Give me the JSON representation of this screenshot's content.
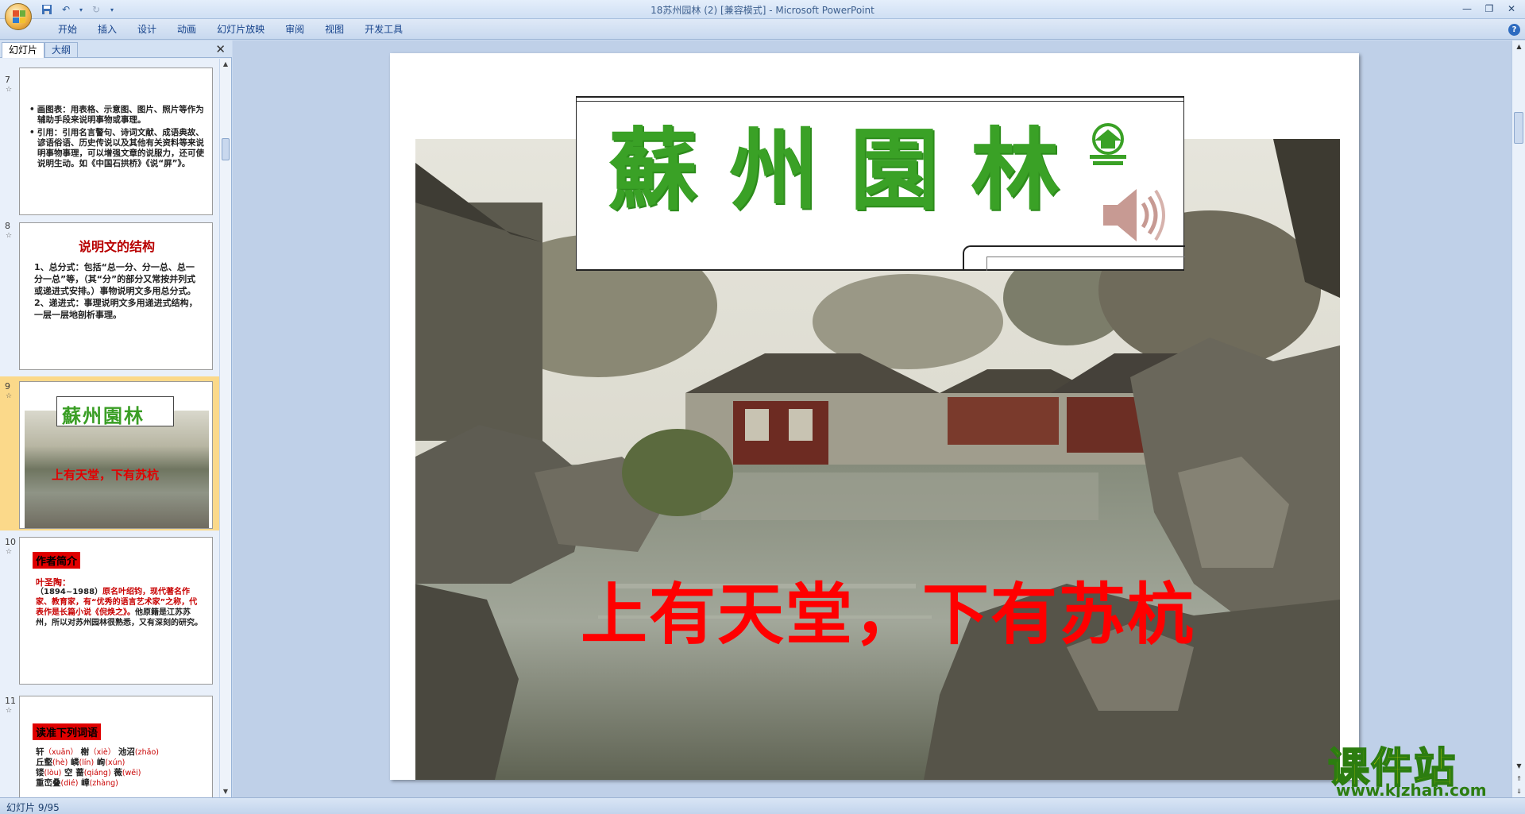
{
  "window": {
    "title": "18苏州园林 (2) [兼容模式] - Microsoft PowerPoint"
  },
  "ribbon": {
    "tabs": [
      "开始",
      "插入",
      "设计",
      "动画",
      "幻灯片放映",
      "审阅",
      "视图",
      "开发工具"
    ]
  },
  "panel": {
    "tab_slides": "幻灯片",
    "tab_outline": "大纲",
    "close": "✕"
  },
  "thumbnails": [
    {
      "number": "7",
      "bullets": [
        "画图表：用表格、示意图、图片、照片等作为辅助手段来说明事物或事理。",
        "引用：引用名言警句、诗词文献、成语典故、谚语俗语、历史传说以及其他有关资料等来说明事物事理，可以增强文章的说服力，还可使说明生动。如《中国石拱桥》《说“屏”》。"
      ]
    },
    {
      "number": "8",
      "title": "说明文的结构",
      "lines": [
        "1、总分式：包括“总一分、分一总、总一分一总”等，（其“分”的部分又常按并列式或递进式安排。）事物说明文多用总分式。",
        "2、递进式：事理说明文多用递进式结构，一层一层地剖析事理。"
      ]
    },
    {
      "number": "9",
      "banner": "蘇州園林",
      "caption": "上有天堂，下有苏杭"
    },
    {
      "number": "10",
      "label": "作者简介",
      "name": "叶圣陶：",
      "years": "（1894~1988）",
      "red_text": "原名叶绍钧，现代著名作家、教育家，有“优秀的语言艺术家”之称，代表作是长篇小说《倪焕之》。",
      "black_text": "他原籍是江苏苏州，所以对苏州园林很熟悉，又有深刻的研究。"
    },
    {
      "number": "11",
      "label": "读准下列词语",
      "rows": [
        [
          {
            "w": "轩",
            "p": "（xuān）"
          },
          {
            "w": "榭",
            "p": "（xiè）"
          },
          {
            "w": "池沼",
            "p": "(zhǎo)"
          }
        ],
        [
          {
            "w": "丘壑",
            "p": "(hè)"
          },
          {
            "w": "嶙",
            "p": "(lín)"
          },
          {
            "w": "峋",
            "p": "(xún)"
          }
        ],
        [
          {
            "w": "镂",
            "p": "(lòu)"
          },
          {
            "w": "空",
            "p": ""
          },
          {
            "w": "蔷",
            "p": "(qiáng)"
          },
          {
            "w": "薇",
            "p": "(wēi)"
          }
        ],
        [
          {
            "w": "重峦叠",
            "p": "(dié)"
          },
          {
            "w": "嶂",
            "p": "(zhàng)"
          }
        ]
      ]
    }
  ],
  "slide": {
    "title": "蘇州園林",
    "caption": "上有天堂，下有苏杭",
    "title_color": "#3aa126",
    "caption_color": "#ff0000"
  },
  "watermark": {
    "text": "课件站",
    "url": "www.kjzhan.com"
  },
  "status": {
    "slide_indicator": "幻灯片 9/95"
  }
}
